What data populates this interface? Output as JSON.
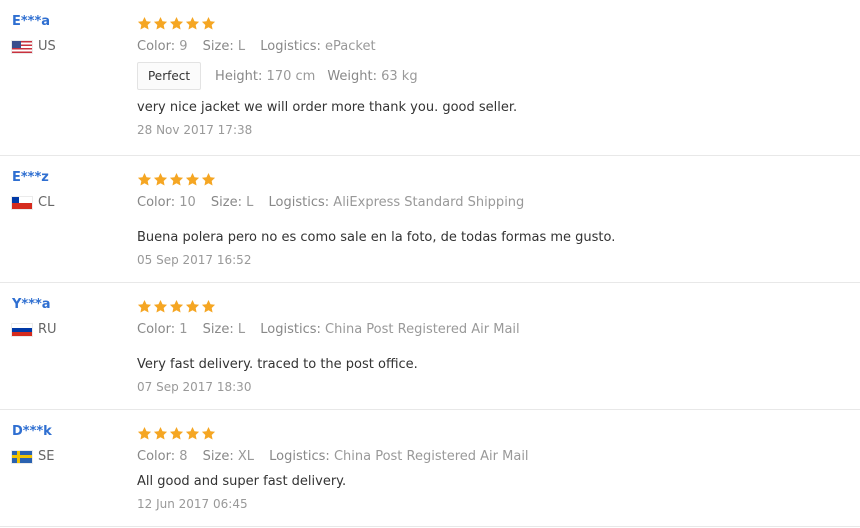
{
  "colors": {
    "star": "#f5a623",
    "username": "#2f6fd1",
    "label": "#999999",
    "text": "#333333",
    "divider": "#e8e8e8"
  },
  "labels": {
    "color": "Color:",
    "size": "Size:",
    "logistics": "Logistics:",
    "height": "Height:",
    "weight": "Weight:"
  },
  "reviews": [
    {
      "user": "E***a",
      "country": "US",
      "flag_icon": "flag-us",
      "rating": 5,
      "color": "9",
      "size": "L",
      "logistics": "ePacket",
      "tag": "Perfect",
      "height": "170 cm",
      "weight": "63 kg",
      "feedback": "very nice jacket we will order more thank you. good seller.",
      "date": "28 Nov 2017 17:38"
    },
    {
      "user": "E***z",
      "country": "CL",
      "flag_icon": "flag-cl",
      "rating": 5,
      "color": "10",
      "size": "L",
      "logistics": "AliExpress Standard Shipping",
      "feedback": "Buena polera pero no es como sale en la foto, de todas formas me gusto.",
      "date": "05 Sep 2017 16:52"
    },
    {
      "user": "Y***a",
      "country": "RU",
      "flag_icon": "flag-ru",
      "rating": 5,
      "color": "1",
      "size": "L",
      "logistics": "China Post Registered Air Mail",
      "feedback": "Very fast delivery. traced to the post office.",
      "date": "07 Sep 2017 18:30"
    },
    {
      "user": "D***k",
      "country": "SE",
      "flag_icon": "flag-se",
      "rating": 5,
      "color": "8",
      "size": "XL",
      "logistics": "China Post Registered Air Mail",
      "feedback": "All good and super fast delivery.",
      "date": "12 Jun 2017 06:45"
    }
  ]
}
